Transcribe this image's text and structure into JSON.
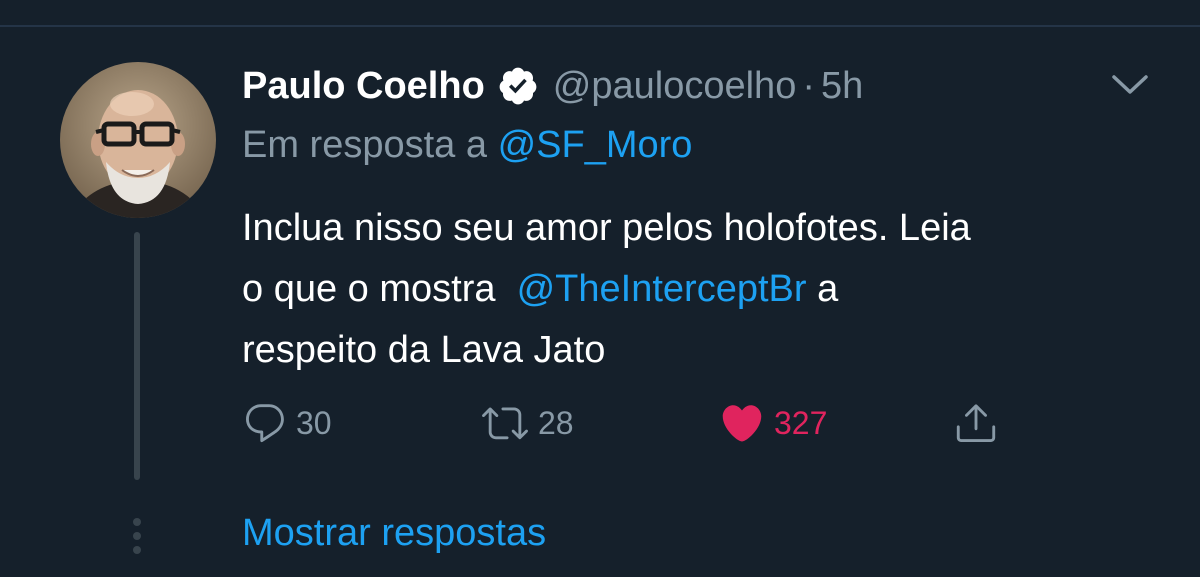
{
  "tweet": {
    "author": {
      "display_name": "Paulo Coelho",
      "handle": "@paulocoelho",
      "verified_icon": "verified-badge-icon",
      "avatar_icon": "avatar-photo"
    },
    "separator": "·",
    "time": "5h",
    "reply_to": {
      "prefix": "Em resposta a",
      "mention": "@SF_Moro"
    },
    "body": {
      "line1": "Inclua nisso seu amor pelos holofotes. Leia",
      "line2_prefix": "o que o mostra",
      "mention": "@TheInterceptBr",
      "line2_suffix": "a",
      "line3": "respeito da Lava Jato"
    },
    "actions": {
      "reply_count": "30",
      "retweet_count": "28",
      "like_count": "327"
    }
  },
  "thread": {
    "show_replies": "Mostrar respostas"
  },
  "colors": {
    "background": "#15202b",
    "text_primary": "#ffffff",
    "text_secondary": "#8899a6",
    "link": "#1da1f2",
    "like": "#e0245e",
    "thread_line": "#38444d"
  }
}
